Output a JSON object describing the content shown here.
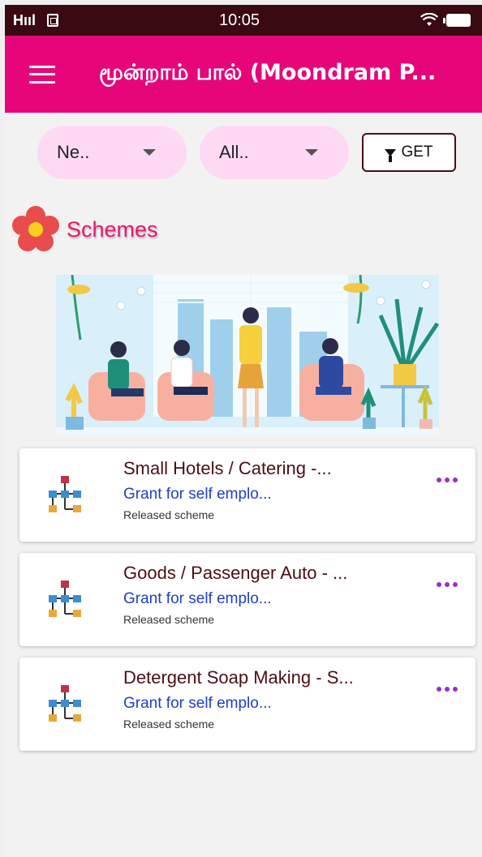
{
  "status_bar": {
    "signal_text": "Hııl",
    "time": "10:05",
    "icons": [
      "signal-icon",
      "sim-icon",
      "wifi-icon",
      "battery-icon"
    ]
  },
  "app_bar": {
    "title": "மூன்றாம் பால் (Moondram P...",
    "menu_icon": "menu-icon"
  },
  "filters": {
    "dropdown1": {
      "selected": "Ne.."
    },
    "dropdown2": {
      "selected": "All.."
    },
    "get_label": "GET"
  },
  "section": {
    "title": "Schemes",
    "icon": "flower-icon"
  },
  "colors": {
    "status_bar": "#3a0a12",
    "app_bar": "#e6067a",
    "dropdown_bg": "#fdd9f4",
    "section_title": "#e01b71",
    "card_title": "#4a0f14",
    "card_subtitle": "#1e3fc8",
    "more_dots": "#9b2fc6"
  },
  "schemes": [
    {
      "title": "Small Hotels / Catering -...",
      "subtitle": "Grant for self emplo...",
      "status": "Released scheme"
    },
    {
      "title": "Goods / Passenger Auto - ...",
      "subtitle": "Grant for self emplo...",
      "status": "Released scheme"
    },
    {
      "title": "Detergent Soap Making - S...",
      "subtitle": "Grant for self emplo...",
      "status": "Released scheme"
    }
  ]
}
